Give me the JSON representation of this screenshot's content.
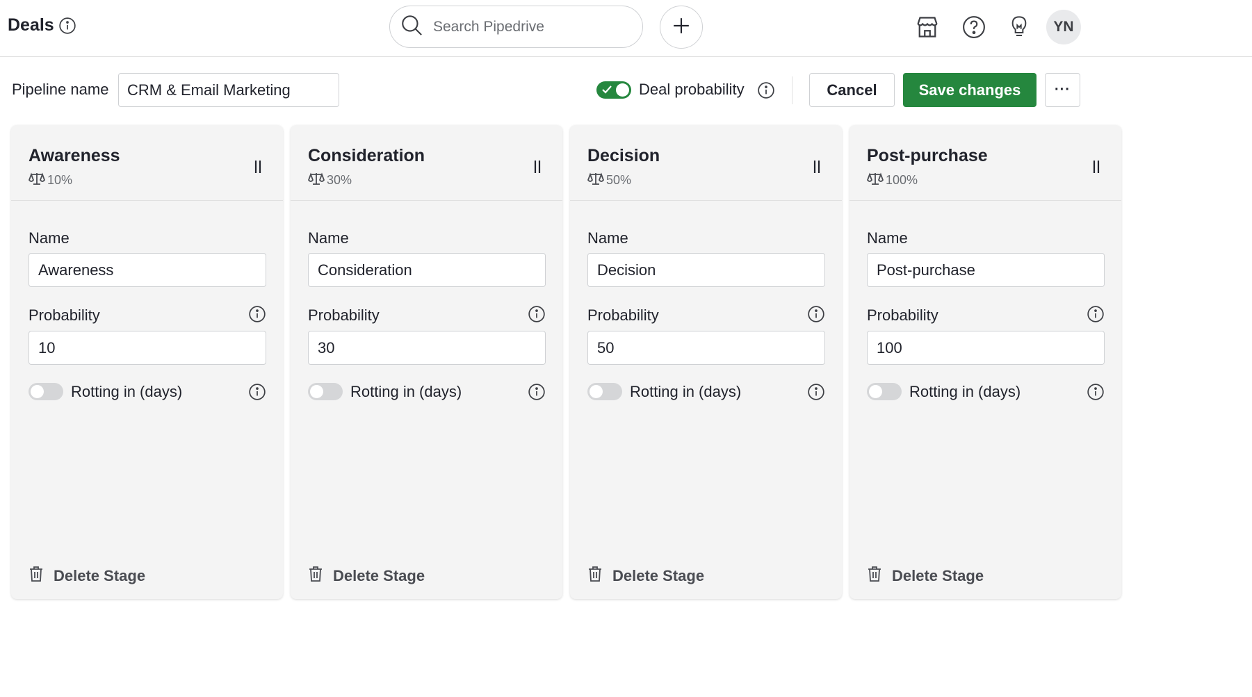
{
  "header": {
    "title": "Deals",
    "search_placeholder": "Search Pipedrive",
    "avatar_initials": "YN",
    "icons": [
      "info-icon",
      "search-icon",
      "plus-icon",
      "marketplace-icon",
      "help-icon",
      "lightbulb-icon"
    ]
  },
  "toolbar": {
    "pipeline_name_label": "Pipeline name",
    "pipeline_name_value": "CRM & Email Marketing",
    "deal_probability_label": "Deal probability",
    "deal_probability_enabled": true,
    "cancel_label": "Cancel",
    "save_label": "Save changes",
    "more_label": "···"
  },
  "colors": {
    "accent_green": "#25873e",
    "column_bg": "#f4f4f4",
    "border": "#cfd1d4"
  },
  "stages": [
    {
      "title": "Awareness",
      "probability_badge": "10%",
      "name_label": "Name",
      "name_value": "Awareness",
      "probability_label": "Probability",
      "probability_value": "10",
      "rotting_label": "Rotting in (days)",
      "rotting_enabled": false,
      "delete_label": "Delete Stage"
    },
    {
      "title": "Consideration",
      "probability_badge": "30%",
      "name_label": "Name",
      "name_value": "Consideration",
      "probability_label": "Probability",
      "probability_value": "30",
      "rotting_label": "Rotting in (days)",
      "rotting_enabled": false,
      "delete_label": "Delete Stage"
    },
    {
      "title": "Decision",
      "probability_badge": "50%",
      "name_label": "Name",
      "name_value": "Decision",
      "probability_label": "Probability",
      "probability_value": "50",
      "rotting_label": "Rotting in (days)",
      "rotting_enabled": false,
      "delete_label": "Delete Stage"
    },
    {
      "title": "Post-purchase",
      "probability_badge": "100%",
      "name_label": "Name",
      "name_value": "Post-purchase",
      "probability_label": "Probability",
      "probability_value": "100",
      "rotting_label": "Rotting in (days)",
      "rotting_enabled": false,
      "delete_label": "Delete Stage"
    }
  ]
}
